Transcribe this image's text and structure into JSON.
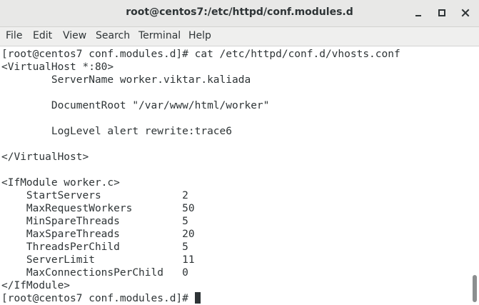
{
  "window": {
    "title": "root@centos7:/etc/httpd/conf.modules.d"
  },
  "icons": {
    "minimize": "minimize-icon",
    "maximize": "maximize-icon",
    "close": "close-icon"
  },
  "menu": {
    "items": [
      "File",
      "Edit",
      "View",
      "Search",
      "Terminal",
      "Help"
    ]
  },
  "terminal": {
    "lines": [
      "[root@centos7 conf.modules.d]# cat /etc/httpd/conf.d/vhosts.conf",
      "<VirtualHost *:80>",
      "        ServerName worker.viktar.kaliada",
      "",
      "        DocumentRoot \"/var/www/html/worker\"",
      "",
      "        LogLevel alert rewrite:trace6",
      "",
      "</VirtualHost>",
      "",
      "<IfModule worker.c>",
      "    StartServers             2",
      "    MaxRequestWorkers        50",
      "    MinSpareThreads          5",
      "    MaxSpareThreads          20",
      "    ThreadsPerChild          5",
      "    ServerLimit              11",
      "    MaxConnectionsPerChild   0",
      "</IfModule>"
    ],
    "prompt": "[root@centos7 conf.modules.d]# "
  },
  "colors": {
    "titlebar_bg": "#e8e8e7",
    "menubar_bg": "#efefee",
    "text": "#2e3436",
    "terminal_bg": "#ffffff",
    "scroll_thumb": "#8b8e8f"
  }
}
